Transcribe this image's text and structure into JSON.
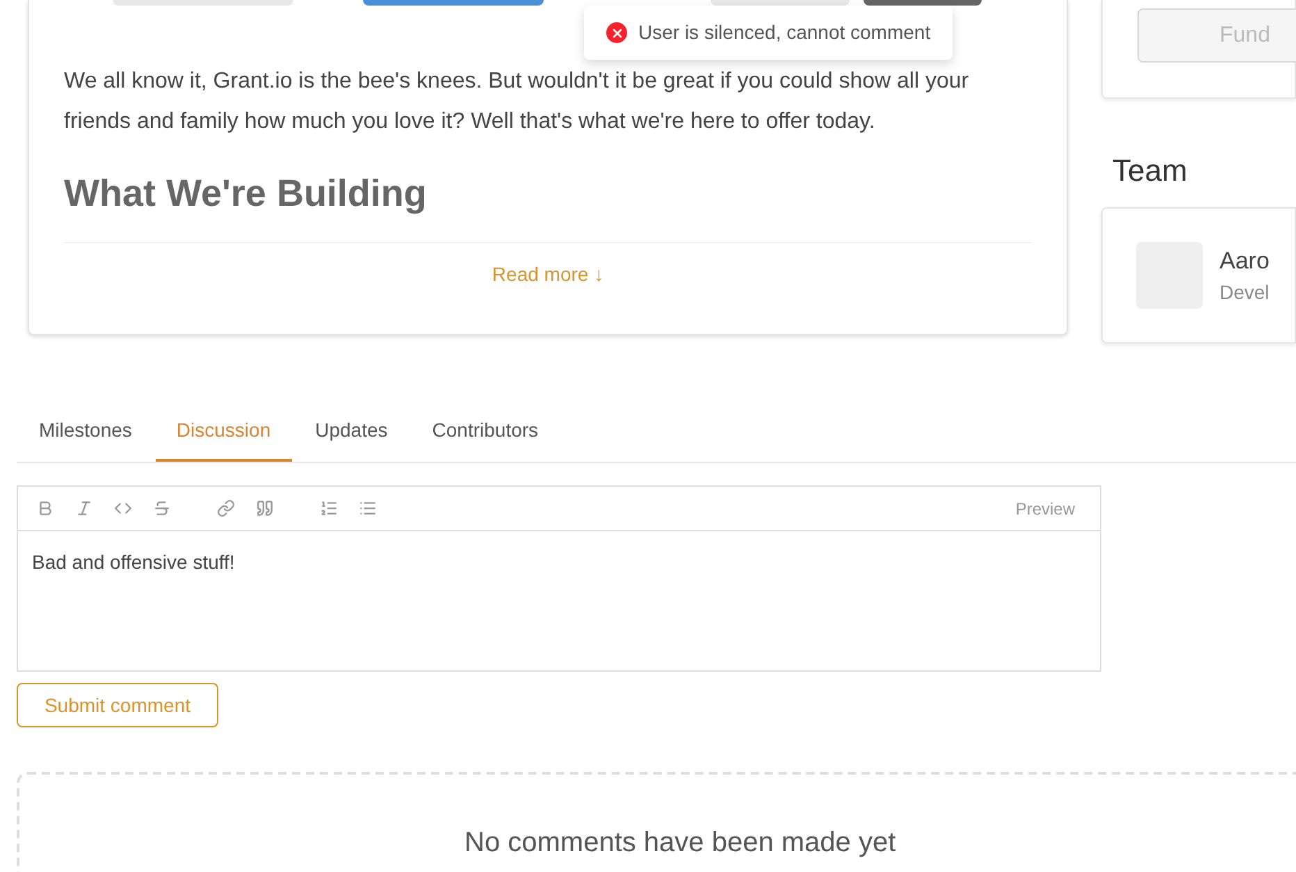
{
  "toast": {
    "kind": "error",
    "message": "User is silenced, cannot comment"
  },
  "article": {
    "paragraph": "We all know it, Grant.io is the bee's knees. But wouldn't it be great if you could show all your friends and family how much you love it? Well that's what we're here to offer today.",
    "heading": "What We're Building",
    "read_more": "Read more ↓"
  },
  "sidebar": {
    "fund_button": "Fund",
    "team_title": "Team",
    "member": {
      "name": "Aaro",
      "role": "Devel"
    }
  },
  "tabs": [
    {
      "label": "Milestones",
      "selected": false
    },
    {
      "label": "Discussion",
      "selected": true
    },
    {
      "label": "Updates",
      "selected": false
    },
    {
      "label": "Contributors",
      "selected": false
    }
  ],
  "editor": {
    "preview": "Preview",
    "value": "Bad and offensive stuff!"
  },
  "submit_button": "Submit comment",
  "empty_state": "No comments have been made yet"
}
